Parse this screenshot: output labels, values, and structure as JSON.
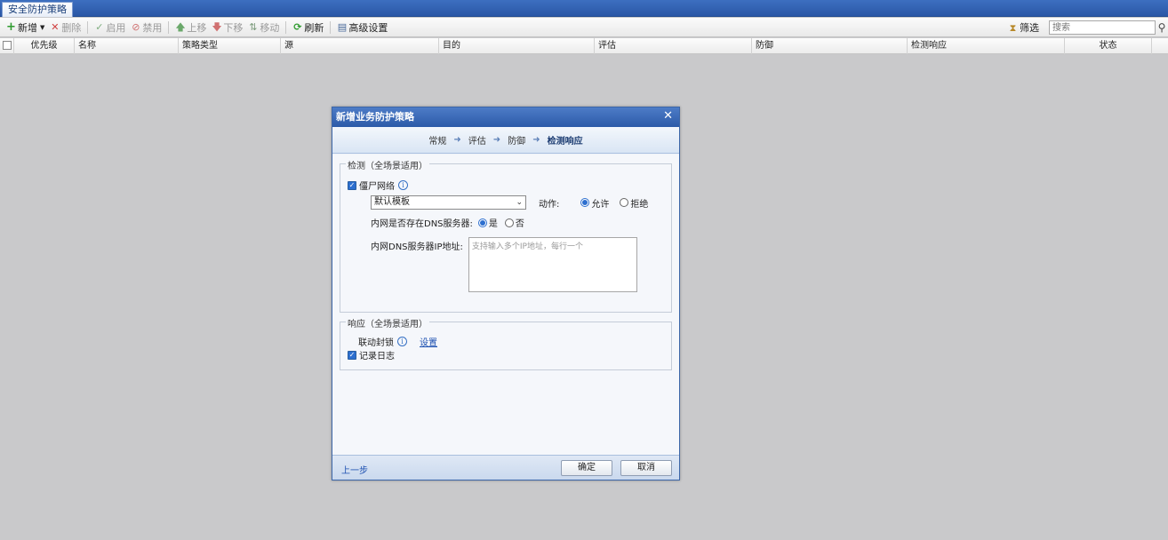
{
  "tab": {
    "label": "安全防护策略"
  },
  "toolbar": {
    "new": "新增",
    "delete": "删除",
    "enable": "启用",
    "disable": "禁用",
    "move_up": "上移",
    "move_down": "下移",
    "move": "移动",
    "refresh": "刷新",
    "advanced": "高级设置",
    "filter": "筛选",
    "search_placeholder": "搜索"
  },
  "grid": {
    "columns": [
      "优先级",
      "名称",
      "策略类型",
      "源",
      "目的",
      "评估",
      "防御",
      "检测响应",
      "状态"
    ]
  },
  "dialog": {
    "title": "新增业务防护策略",
    "steps": [
      "常规",
      "评估",
      "防御",
      "检测响应"
    ],
    "detect_group": {
      "legend": "检测（全场景适用）",
      "botnet_label": "僵尸网络",
      "template_value": "默认模板",
      "action_label": "动作:",
      "allow_label": "允许",
      "deny_label": "拒绝",
      "dns_exists_label": "内网是否存在DNS服务器:",
      "yes_label": "是",
      "no_label": "否",
      "dns_ip_label": "内网DNS服务器IP地址:",
      "dns_ip_placeholder": "支持输入多个IP地址，每行一个"
    },
    "response_group": {
      "legend": "响应（全场景适用）",
      "linkage_label": "联动封锁",
      "settings_link": "设置",
      "log_label": "记录日志"
    },
    "footer": {
      "prev": "上一步",
      "ok": "确定",
      "cancel": "取消"
    }
  },
  "colors": {
    "title_bar": "#2c5aa8",
    "accent": "#2d6fcf",
    "background": "#c9c9cb"
  }
}
